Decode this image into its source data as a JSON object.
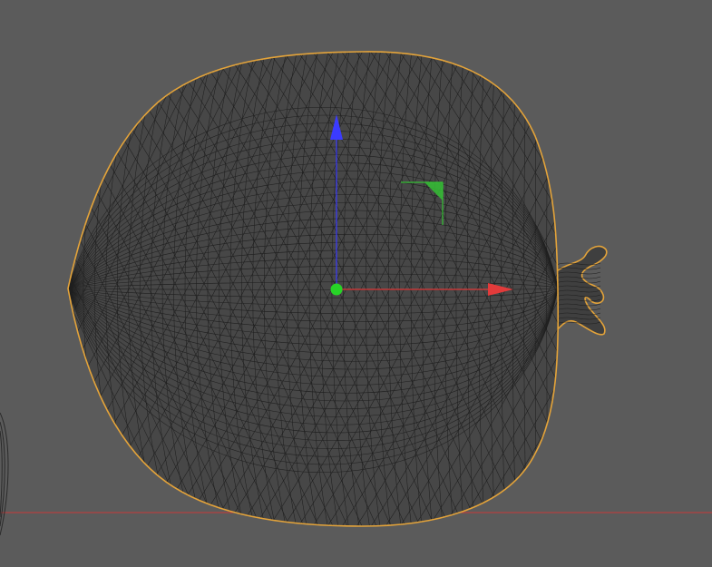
{
  "viewport": {
    "background": "#5b5b5b",
    "view": "orthographic-top",
    "shading": "wireframe"
  },
  "scene": {
    "object": {
      "shape": "fruit-like sphere mesh",
      "selected": true,
      "selection_outline_color": "#e3a33a",
      "wire_color": "#1f1f1f",
      "fill_color": "#474747"
    },
    "partial_object_left_edge": true,
    "grid_axis_line_color": "#c83a3a"
  },
  "gizmo": {
    "x_axis_color": "#e23b3b",
    "y_axis_color": "#3b3bff",
    "center_color": "#27d427",
    "plane_handle_color": "#35c035"
  }
}
